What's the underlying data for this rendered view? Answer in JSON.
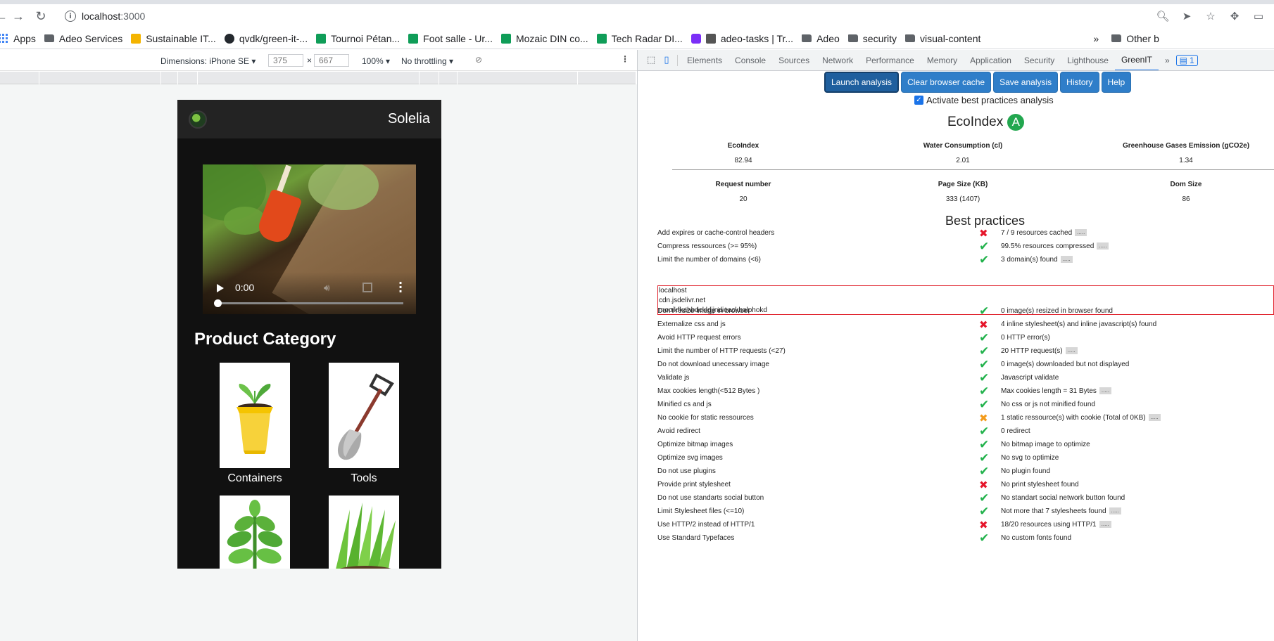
{
  "browser": {
    "url_host": "localhost",
    "url_port": ":3000",
    "bookmarks": [
      "Apps",
      "Adeo Services",
      "Sustainable IT...",
      "qvdk/green-it-...",
      "Tournoi Pétan...",
      "Foot salle - Ur...",
      "Mozaic DIN co...",
      "Tech Radar DI...",
      "adeo-tasks | Tr...",
      "Adeo",
      "security",
      "visual-content"
    ],
    "bookmarks_more": "»",
    "other_bookmarks": "Other b"
  },
  "device_toolbar": {
    "dimensions_label": "Dimensions: iPhone SE",
    "width": "375",
    "times": "×",
    "height": "667",
    "zoom": "100%",
    "throttling": "No throttling"
  },
  "page": {
    "brand": "Solelia",
    "video_time": "0:00",
    "category_title": "Product Category",
    "categories": [
      "Containers",
      "Tools"
    ]
  },
  "devtools": {
    "tabs": [
      "Elements",
      "Console",
      "Sources",
      "Network",
      "Performance",
      "Memory",
      "Application",
      "Security",
      "Lighthouse",
      "GreenIT"
    ],
    "more": "»",
    "issues_count": "1"
  },
  "greenit": {
    "buttons": [
      "Launch analysis",
      "Clear browser cache",
      "Save analysis",
      "History",
      "Help"
    ],
    "checkbox_label": "Activate best practices analysis",
    "eco_title": "EcoIndex",
    "eco_grade": "A",
    "metrics_row1": [
      {
        "label": "EcoIndex",
        "value": "82.94"
      },
      {
        "label": "Water Consumption (cl)",
        "value": "2.01"
      },
      {
        "label": "Greenhouse Gases Emission (gCO2e)",
        "value": "1.34"
      }
    ],
    "metrics_row2": [
      {
        "label": "Request number",
        "value": "20"
      },
      {
        "label": "Page Size (KB)",
        "value": "333 (1407)"
      },
      {
        "label": "Dom Size",
        "value": "86"
      }
    ],
    "best_practices_title": "Best practices",
    "domains": [
      "localhost",
      "cdn.jsdelivr.net",
      "mooikfkahbdckldjjndioackbalphokd"
    ],
    "practices": [
      {
        "name": "Add expires or cache-control headers",
        "status": "ko",
        "result": "7 / 9 resources cached",
        "more": "....."
      },
      {
        "name": "Compress ressources (>= 95%)",
        "status": "ok",
        "result": "99.5% resources compressed",
        "more": "....."
      },
      {
        "name": "Limit the number of domains (<6)",
        "status": "ok",
        "result": "3 domain(s) found",
        "more": "....."
      },
      {
        "name": "Don't resize image in browser",
        "status": "ok",
        "result": "0 image(s) resized in browser found",
        "more": ""
      },
      {
        "name": "Externalize css and js",
        "status": "ko",
        "result": "4 inline stylesheet(s) and inline javascript(s) found",
        "more": ""
      },
      {
        "name": "Avoid HTTP request errors",
        "status": "ok",
        "result": "0 HTTP error(s)",
        "more": ""
      },
      {
        "name": "Limit the number of HTTP requests (<27)",
        "status": "ok",
        "result": "20 HTTP request(s)",
        "more": "....."
      },
      {
        "name": "Do not download unecessary image",
        "status": "ok",
        "result": "0 image(s) downloaded but not displayed",
        "more": ""
      },
      {
        "name": "Validate js",
        "status": "ok",
        "result": "Javascript validate",
        "more": ""
      },
      {
        "name": "Max cookies length(<512 Bytes )",
        "status": "ok",
        "result": "Max cookies length = 31 Bytes",
        "more": "....."
      },
      {
        "name": "Minified cs and js",
        "status": "ok",
        "result": "No css or js not minified found",
        "more": ""
      },
      {
        "name": "No cookie for static ressources",
        "status": "warn",
        "result": "1 static ressource(s) with cookie (Total of 0KB)",
        "more": "....."
      },
      {
        "name": "Avoid redirect",
        "status": "ok",
        "result": "0 redirect",
        "more": ""
      },
      {
        "name": "Optimize bitmap images",
        "status": "ok",
        "result": "No bitmap image to optimize",
        "more": ""
      },
      {
        "name": "Optimize svg images",
        "status": "ok",
        "result": "No svg to optimize",
        "more": ""
      },
      {
        "name": "Do not use plugins",
        "status": "ok",
        "result": "No plugin found",
        "more": ""
      },
      {
        "name": "Provide print stylesheet",
        "status": "ko",
        "result": "No print stylesheet found",
        "more": ""
      },
      {
        "name": "Do not use standarts social button",
        "status": "ok",
        "result": "No standart social network button found",
        "more": ""
      },
      {
        "name": "Limit Stylesheet files (<=10)",
        "status": "ok",
        "result": "Not more that 7 stylesheets found",
        "more": "....."
      },
      {
        "name": "Use HTTP/2 instead of HTTP/1",
        "status": "ko",
        "result": "18/20 resources using HTTP/1",
        "more": "....."
      },
      {
        "name": "Use Standard Typefaces",
        "status": "ok",
        "result": "No custom fonts found",
        "more": ""
      }
    ]
  }
}
